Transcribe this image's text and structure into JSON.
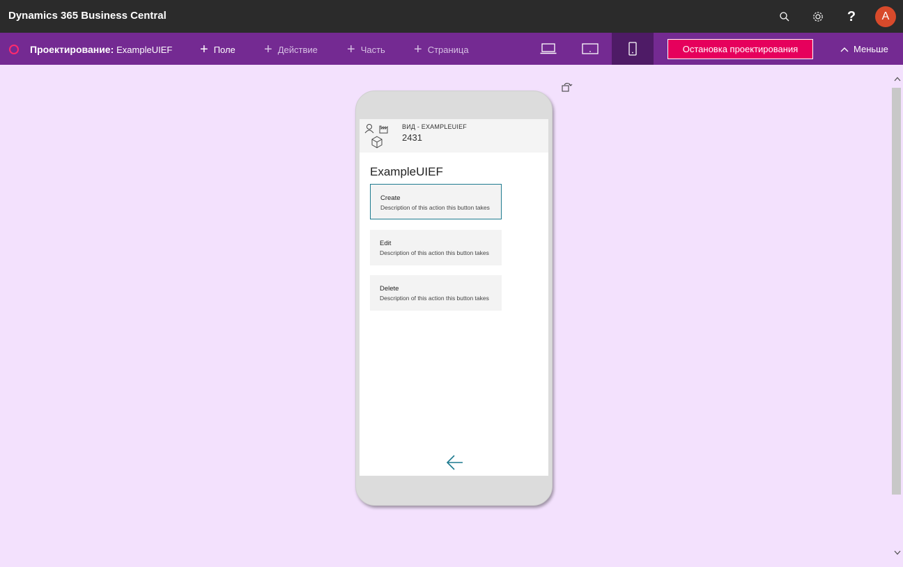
{
  "app": {
    "title": "Dynamics 365 Business Central"
  },
  "topbar": {
    "icons": [
      "search-icon",
      "gear-icon",
      "help-icon"
    ],
    "help_glyph": "?",
    "avatar_initial": "A",
    "avatar_color": "#d84a2b"
  },
  "designer": {
    "label": "Проектирование:",
    "page_name": "ExampleUIEF",
    "add_items": [
      {
        "label": "Поле",
        "enabled": true
      },
      {
        "label": "Действие",
        "enabled": false
      },
      {
        "label": "Часть",
        "enabled": false
      },
      {
        "label": "Страница",
        "enabled": false
      }
    ],
    "devices": [
      "desktop-icon",
      "tablet-icon",
      "phone-icon"
    ],
    "active_device": "phone",
    "stop_label": "Остановка проектирования",
    "less_label": "Меньше",
    "accent": "#742a92",
    "stop_color": "#e6005c"
  },
  "phone": {
    "header_caption": "ВИД - EXAMPLEUIEF",
    "header_value": "2431",
    "page_title": "ExampleUIEF",
    "actions": [
      {
        "title": "Create",
        "description": "Description of this action this button takes",
        "selected": true
      },
      {
        "title": "Edit",
        "description": "Description of this action this button takes",
        "selected": false
      },
      {
        "title": "Delete",
        "description": "Description of this action this button takes",
        "selected": false
      }
    ]
  }
}
